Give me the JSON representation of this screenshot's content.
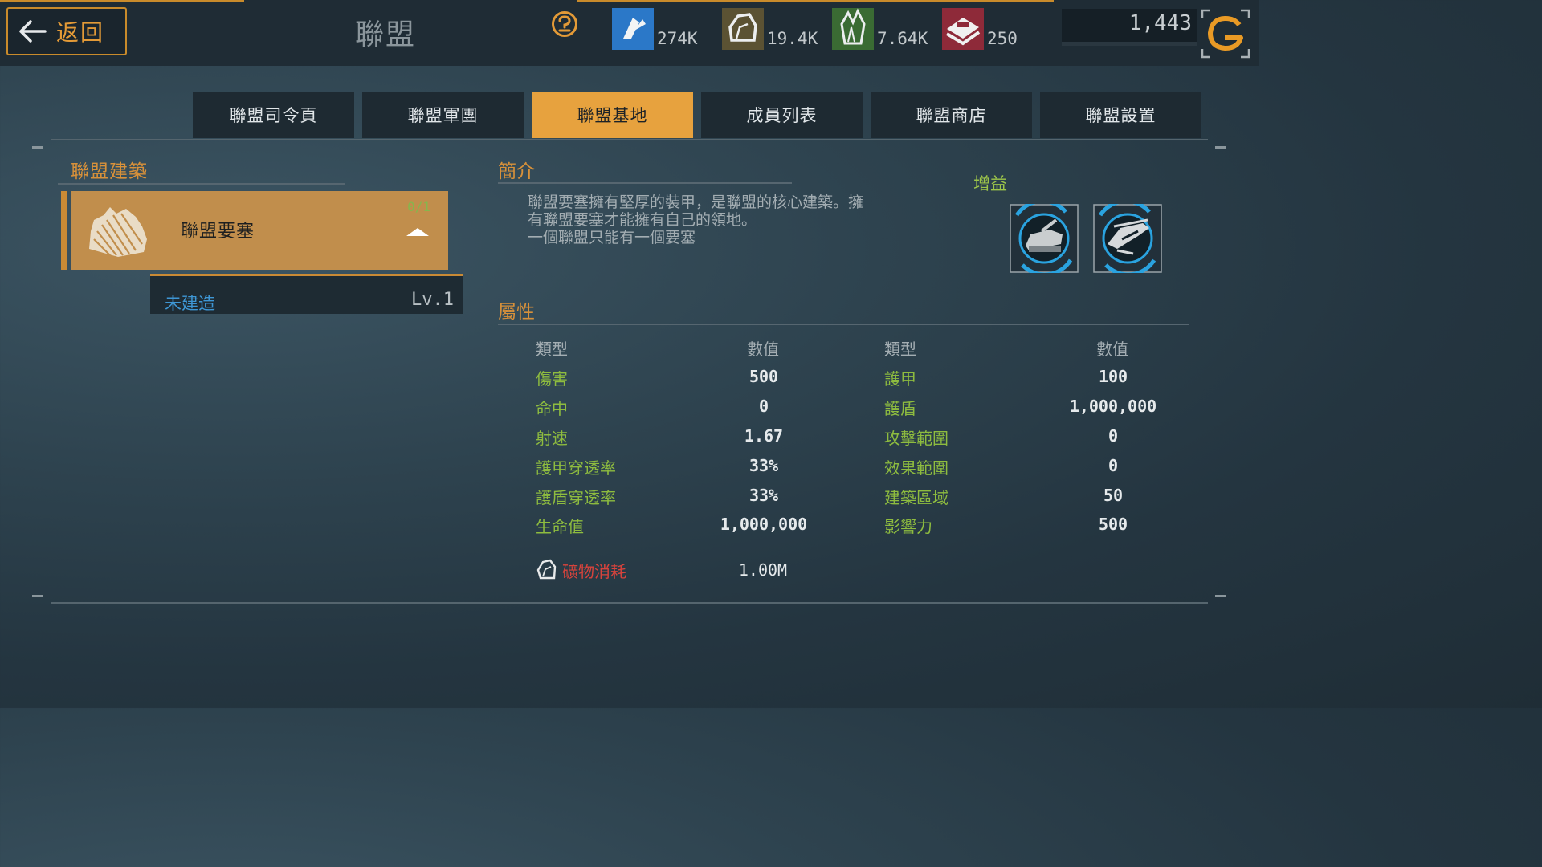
{
  "header": {
    "back_label": "返回",
    "title": "聯盟",
    "resources": [
      {
        "icon": "power-cell-icon",
        "value": "274K",
        "color": "#2b78c8"
      },
      {
        "icon": "ore-icon",
        "value": "19.4K",
        "color": "#7a6c3c"
      },
      {
        "icon": "crystal-icon",
        "value": "7.64K",
        "color": "#3f7a35"
      },
      {
        "icon": "supply-crate-icon",
        "value": "250",
        "color": "#9c2c3c"
      }
    ],
    "power_value": "1,443"
  },
  "tabs": [
    {
      "label": "聯盟司令頁",
      "active": false
    },
    {
      "label": "聯盟軍團",
      "active": false
    },
    {
      "label": "聯盟基地",
      "active": true
    },
    {
      "label": "成員列表",
      "active": false
    },
    {
      "label": "聯盟商店",
      "active": false
    },
    {
      "label": "聯盟設置",
      "active": false
    }
  ],
  "left": {
    "section_title": "聯盟建築",
    "card": {
      "name": "聯盟要塞",
      "count": "0/1"
    },
    "status": "未建造",
    "level": "Lv.1"
  },
  "intro": {
    "title": "簡介",
    "lines": [
      "聯盟要塞擁有堅厚的裝甲，是聯盟的核心建築。擁",
      "有聯盟要塞才能擁有自己的領地。",
      "一個聯盟只能有一個要塞"
    ]
  },
  "buff": {
    "title": "增益",
    "icons": [
      "tank-buff-icon",
      "aircraft-buff-icon"
    ]
  },
  "attributes": {
    "title": "屬性",
    "col_type": "類型",
    "col_value": "數值",
    "left": [
      {
        "label": "傷害",
        "value": "500"
      },
      {
        "label": "命中",
        "value": "0"
      },
      {
        "label": "射速",
        "value": "1.67"
      },
      {
        "label": "護甲穿透率",
        "value": "33%"
      },
      {
        "label": "護盾穿透率",
        "value": "33%"
      },
      {
        "label": "生命值",
        "value": "1,000,000"
      }
    ],
    "right": [
      {
        "label": "護甲",
        "value": "100"
      },
      {
        "label": "護盾",
        "value": "1,000,000"
      },
      {
        "label": "攻擊範圍",
        "value": "0"
      },
      {
        "label": "效果範圍",
        "value": "0"
      },
      {
        "label": "建築區域",
        "value": "50"
      },
      {
        "label": "影響力",
        "value": "500"
      }
    ]
  },
  "cost": {
    "label": "礦物消耗",
    "value": "1.00M"
  },
  "colors": {
    "accent": "#e7a23e",
    "green": "#8ebc3f",
    "red": "#d8433c",
    "blue": "#3e96d4"
  }
}
